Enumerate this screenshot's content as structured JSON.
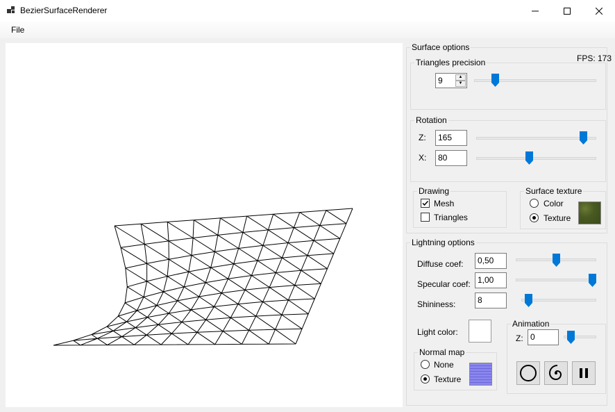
{
  "window": {
    "title": "BezierSurfaceRenderer"
  },
  "menu": {
    "file": "File"
  },
  "surface_options": {
    "legend": "Surface options",
    "fps": "FPS: 173",
    "triangles": {
      "legend": "Triangles precision",
      "value": "9",
      "slider": 0.15
    },
    "rotation": {
      "legend": "Rotation",
      "z_label": "Z:",
      "z_value": "165",
      "z_slider": 0.92,
      "x_label": "X:",
      "x_value": "80",
      "x_slider": 0.44
    },
    "drawing": {
      "legend": "Drawing",
      "mesh": "Mesh",
      "mesh_checked": true,
      "triangles": "Triangles",
      "triangles_checked": false
    },
    "texture": {
      "legend": "Surface texture",
      "color": "Color",
      "texture": "Texture",
      "selected": "texture"
    }
  },
  "lighting": {
    "legend": "Lightning options",
    "diffuse_label": "Diffuse  coef:",
    "diffuse_value": "0,50",
    "diffuse_slider": 0.5,
    "specular_label": "Specular coef:",
    "specular_value": "1,00",
    "specular_slider": 1.0,
    "shininess_label": "Shininess:",
    "shininess_value": "8",
    "shininess_slider": 0.05,
    "light_color_label": "Light color:",
    "normal_map": {
      "legend": "Normal map",
      "none": "None",
      "texture": "Texture",
      "selected": "texture"
    },
    "animation": {
      "legend": "Animation",
      "z_label": "Z:",
      "z_value": "0",
      "z_slider": 0.15
    }
  }
}
